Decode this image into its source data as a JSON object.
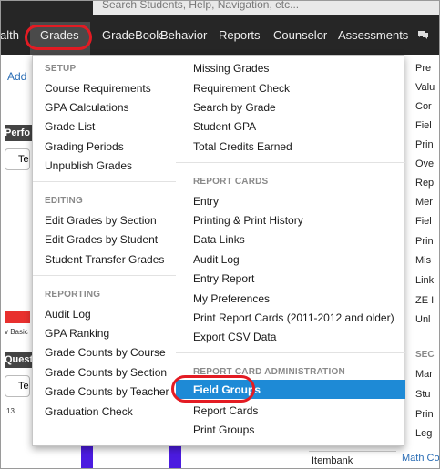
{
  "search": {
    "placeholder": "Search Students, Help, Navigation, etc..."
  },
  "nav": {
    "items": [
      "alth",
      "Grades",
      "GradeBook",
      "Behavior",
      "Reports",
      "Counselor",
      "Assessments"
    ],
    "active": "Grades",
    "chat_icon": "chat-bubbles-icon"
  },
  "background": {
    "add_link": "Add",
    "perf_label": "Perfo",
    "tes_label_1": "Tes",
    "basic_label": "v Basic",
    "quest_label": "Quest",
    "tes_label_2": "Tes",
    "small_num": "13",
    "itembank": "Itembank",
    "math_link": "Math Co",
    "right_column": [
      "Pre",
      "Valu",
      "Cor",
      "Fiel",
      "Prin",
      "Ove",
      "Rep",
      "Mer",
      "Fiel",
      "Prin",
      "Mis",
      "Link",
      "ZE I",
      "Unl",
      "SEC",
      "Mar",
      "Stu",
      "Prin",
      "Leg"
    ]
  },
  "menu": {
    "left": [
      {
        "section": "SETUP",
        "items": [
          "Course Requirements",
          "GPA Calculations",
          "Grade List",
          "Grading Periods",
          "Unpublish Grades"
        ]
      },
      {
        "section": "EDITING",
        "items": [
          "Edit Grades by Section",
          "Edit Grades by Student",
          "Student Transfer Grades"
        ]
      },
      {
        "section": "REPORTING",
        "items": [
          "Audit Log",
          "GPA Ranking",
          "Grade Counts by Course",
          "Grade Counts by Section",
          "Grade Counts by Teacher",
          "Graduation Check"
        ]
      }
    ],
    "right": [
      {
        "section": "",
        "items": [
          "Missing Grades",
          "Requirement Check",
          "Search by Grade",
          "Student GPA",
          "Total Credits Earned"
        ]
      },
      {
        "section": "REPORT CARDS",
        "items": [
          "Entry",
          "Printing & Print History",
          "Data Links",
          "Audit Log",
          "Entry Report",
          "My Preferences",
          "Print Report Cards (2011-2012 and older)",
          "Export CSV Data"
        ]
      },
      {
        "section": "REPORT CARD ADMINISTRATION",
        "items": [
          "Field Groups",
          "Report Cards",
          "Print Groups"
        ]
      }
    ],
    "selected": "Field Groups"
  },
  "colors": {
    "topbar": "#262626",
    "highlight": "#1e8ad6",
    "annotation": "#e31b23",
    "link": "#2a6db5"
  }
}
